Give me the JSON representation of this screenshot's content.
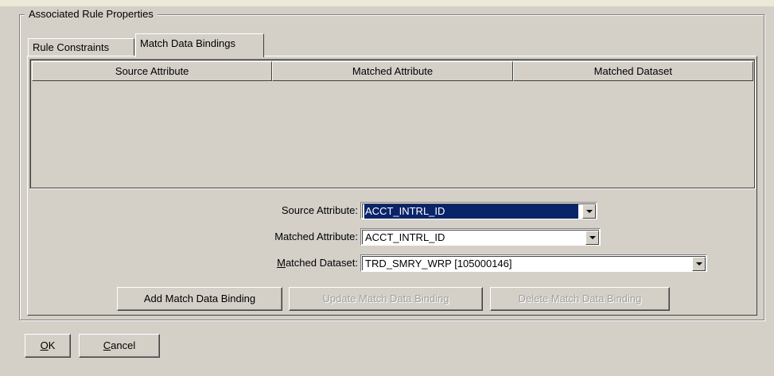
{
  "group": {
    "legend": "Associated Rule Properties"
  },
  "tabs": [
    {
      "label": "Rule Constraints",
      "selected": false
    },
    {
      "label": "Match Data Bindings",
      "selected": true
    }
  ],
  "table": {
    "columns": [
      "Source Attribute",
      "Matched Attribute",
      "Matched Dataset"
    ],
    "rows": []
  },
  "form": {
    "source_attribute": {
      "label": "Source Attribute:",
      "value": "ACCT_INTRL_ID",
      "focused": true
    },
    "matched_attribute": {
      "label": "Matched Attribute:",
      "value": "ACCT_INTRL_ID"
    },
    "matched_dataset": {
      "label_mnemonic": "M",
      "label_rest": "atched Dataset:",
      "value": "TRD_SMRY_WRP [105000146]"
    }
  },
  "buttons": {
    "add": {
      "label": "Add Match Data Binding",
      "enabled": true
    },
    "update": {
      "label": "Update Match Data Binding",
      "enabled": false
    },
    "delete": {
      "label": "Delete Match Data Binding",
      "enabled": false
    }
  },
  "footer": {
    "ok_mnemonic": "O",
    "ok_rest": "K",
    "cancel_mnemonic": "C",
    "cancel_rest": "ancel"
  },
  "colors": {
    "dialog_bg": "#d4d0c8",
    "selection_bg": "#0a246a",
    "selection_fg": "#ffffff",
    "disabled_text": "#a0a0a0"
  }
}
